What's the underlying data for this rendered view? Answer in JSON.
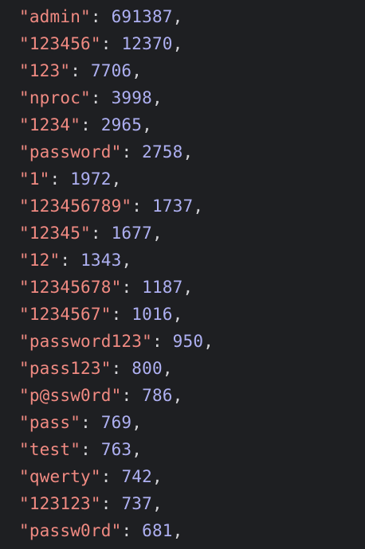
{
  "theme": {
    "background": "#1e1f22",
    "string_color": "#f08a82",
    "number_color": "#aeb0f2",
    "punctuation_color": "#d4d4d8"
  },
  "entries": [
    {
      "key": "\"admin\"",
      "value": "691387"
    },
    {
      "key": "\"123456\"",
      "value": "12370"
    },
    {
      "key": "\"123\"",
      "value": "7706"
    },
    {
      "key": "\"nproc\"",
      "value": "3998"
    },
    {
      "key": "\"1234\"",
      "value": "2965"
    },
    {
      "key": "\"password\"",
      "value": "2758"
    },
    {
      "key": "\"1\"",
      "value": "1972"
    },
    {
      "key": "\"123456789\"",
      "value": "1737"
    },
    {
      "key": "\"12345\"",
      "value": "1677"
    },
    {
      "key": "\"12\"",
      "value": "1343"
    },
    {
      "key": "\"12345678\"",
      "value": "1187"
    },
    {
      "key": "\"1234567\"",
      "value": "1016"
    },
    {
      "key": "\"password123\"",
      "value": "950"
    },
    {
      "key": "\"pass123\"",
      "value": "800"
    },
    {
      "key": "\"p@ssw0rd\"",
      "value": "786"
    },
    {
      "key": "\"pass\"",
      "value": "769"
    },
    {
      "key": "\"test\"",
      "value": "763"
    },
    {
      "key": "\"qwerty\"",
      "value": "742"
    },
    {
      "key": "\"123123\"",
      "value": "737"
    },
    {
      "key": "\"passw0rd\"",
      "value": "681"
    }
  ]
}
